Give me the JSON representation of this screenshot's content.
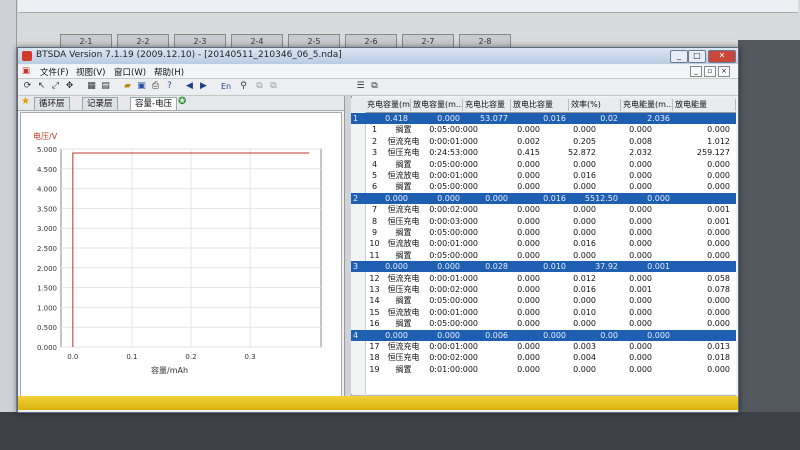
{
  "background": {
    "tabs": [
      "2-1",
      "2-2",
      "2-3",
      "2-4",
      "2-5",
      "2-6",
      "2-7",
      "2-8"
    ]
  },
  "window": {
    "title": "BTSDA Version 7.1.19 (2009.12.10)    - [20140511_210346_06_5.nda]",
    "buttons": {
      "minimize": "_",
      "maximize": "□",
      "close": "✕"
    },
    "mdi_buttons": {
      "minimize": "_",
      "restore": "▫",
      "close": "×"
    }
  },
  "menu": {
    "items": [
      "文件(F)",
      "视图(V)",
      "窗口(W)",
      "帮助(H)"
    ]
  },
  "toolbar": {
    "left_icons": [
      "refresh-icon",
      "pointer-icon",
      "zoom-icon",
      "cursor-icon",
      "table-icon",
      "chart-icon",
      "open-folder-icon",
      "save-icon",
      "print-icon",
      "help-icon",
      "back-icon",
      "forward-icon"
    ],
    "en_label": "En",
    "right_icons": [
      "list-icon",
      "copy-icon"
    ]
  },
  "tabs": [
    "循环层",
    "记录层",
    "容量-电压"
  ],
  "chart_data": {
    "type": "line",
    "ylabel": "电压/V",
    "xlabel": "容量/mAh",
    "yticks": [
      "5.000",
      "4.500",
      "4.000",
      "3.500",
      "3.000",
      "2.500",
      "2.000",
      "1.500",
      "1.000",
      "0.500",
      "0.000"
    ],
    "xticks": [
      "0.0",
      "0.1",
      "0.2",
      "0.3"
    ],
    "ylim": [
      0,
      5.0
    ],
    "xlim": [
      -0.02,
      0.42
    ],
    "grid": true,
    "series": [
      {
        "x": [
          0.0,
          0.0,
          0.4
        ],
        "y": [
          0.0,
          4.9,
          4.9
        ],
        "color": "#c0392b"
      }
    ]
  },
  "table": {
    "headers": [
      "充电容量(m...",
      "放电容量(m...",
      "充电比容量",
      "放电比容量",
      "效率(%)",
      "充电能量(m...",
      "放电能量"
    ],
    "rows": [
      {
        "type": "cycle",
        "cells": [
          "1",
          "0.418",
          "0.000",
          "53.077",
          "0.016",
          "0.02",
          "2.036",
          ""
        ]
      },
      {
        "type": "step",
        "cells": [
          "1",
          "搁置",
          "0:05:00:000",
          "0.000",
          "0.000",
          "0.000",
          "0.000"
        ]
      },
      {
        "type": "step",
        "cells": [
          "2",
          "恒流充电",
          "0:00:01:000",
          "0.002",
          "0.205",
          "0.008",
          "1.012"
        ]
      },
      {
        "type": "step",
        "cells": [
          "3",
          "恒压充电",
          "0:24:53:000",
          "0.415",
          "52.872",
          "2.032",
          "259.127"
        ]
      },
      {
        "type": "step",
        "cells": [
          "4",
          "搁置",
          "0:05:00:000",
          "0.000",
          "0.000",
          "0.000",
          "0.000"
        ]
      },
      {
        "type": "step",
        "cells": [
          "5",
          "恒流放电",
          "0:00:01:000",
          "0.000",
          "0.016",
          "0.000",
          "0.000"
        ]
      },
      {
        "type": "step",
        "cells": [
          "6",
          "搁置",
          "0:05:00:000",
          "0.000",
          "0.000",
          "0.000",
          "0.000"
        ]
      },
      {
        "type": "cycle",
        "cells": [
          "2",
          "0.000",
          "0.000",
          "0.000",
          "0.016",
          "5512.50",
          "0.000",
          ""
        ]
      },
      {
        "type": "step",
        "cells": [
          "7",
          "恒流充电",
          "0:00:02:000",
          "0.000",
          "0.000",
          "0.000",
          "0.001"
        ]
      },
      {
        "type": "step",
        "cells": [
          "8",
          "恒压充电",
          "0:00:03:000",
          "0.000",
          "0.000",
          "0.000",
          "0.001"
        ]
      },
      {
        "type": "step",
        "cells": [
          "9",
          "搁置",
          "0:05:00:000",
          "0.000",
          "0.000",
          "0.000",
          "0.000"
        ]
      },
      {
        "type": "step",
        "cells": [
          "10",
          "恒流放电",
          "0:00:01:000",
          "0.000",
          "0.016",
          "0.000",
          "0.000"
        ]
      },
      {
        "type": "step",
        "cells": [
          "11",
          "搁置",
          "0:05:00:000",
          "0.000",
          "0.000",
          "0.000",
          "0.000"
        ]
      },
      {
        "type": "cycle",
        "cells": [
          "3",
          "0.000",
          "0.000",
          "0.028",
          "0.010",
          "37.92",
          "0.001",
          ""
        ]
      },
      {
        "type": "step",
        "cells": [
          "12",
          "恒流充电",
          "0:00:01:000",
          "0.000",
          "0.012",
          "0.000",
          "0.058"
        ]
      },
      {
        "type": "step",
        "cells": [
          "13",
          "恒压充电",
          "0:00:02:000",
          "0.000",
          "0.016",
          "0.001",
          "0.078"
        ]
      },
      {
        "type": "step",
        "cells": [
          "14",
          "搁置",
          "0:05:00:000",
          "0.000",
          "0.000",
          "0.000",
          "0.000"
        ]
      },
      {
        "type": "step",
        "cells": [
          "15",
          "恒流放电",
          "0:00:01:000",
          "0.000",
          "0.010",
          "0.000",
          "0.000"
        ]
      },
      {
        "type": "step",
        "cells": [
          "16",
          "搁置",
          "0:05:00:000",
          "0.000",
          "0.000",
          "0.000",
          "0.000"
        ]
      },
      {
        "type": "cycle",
        "cells": [
          "4",
          "0.000",
          "0.000",
          "0.006",
          "0.000",
          "0.00",
          "0.000",
          ""
        ]
      },
      {
        "type": "step",
        "cells": [
          "17",
          "恒流充电",
          "0:00:01:000",
          "0.000",
          "0.003",
          "0.000",
          "0.013"
        ]
      },
      {
        "type": "step",
        "cells": [
          "18",
          "恒压充电",
          "0:00:02:000",
          "0.000",
          "0.004",
          "0.000",
          "0.018"
        ]
      },
      {
        "type": "step",
        "cells": [
          "19",
          "搁置",
          "0:01:00:000",
          "0.000",
          "0.000",
          "0.000",
          "0.000"
        ]
      }
    ]
  }
}
